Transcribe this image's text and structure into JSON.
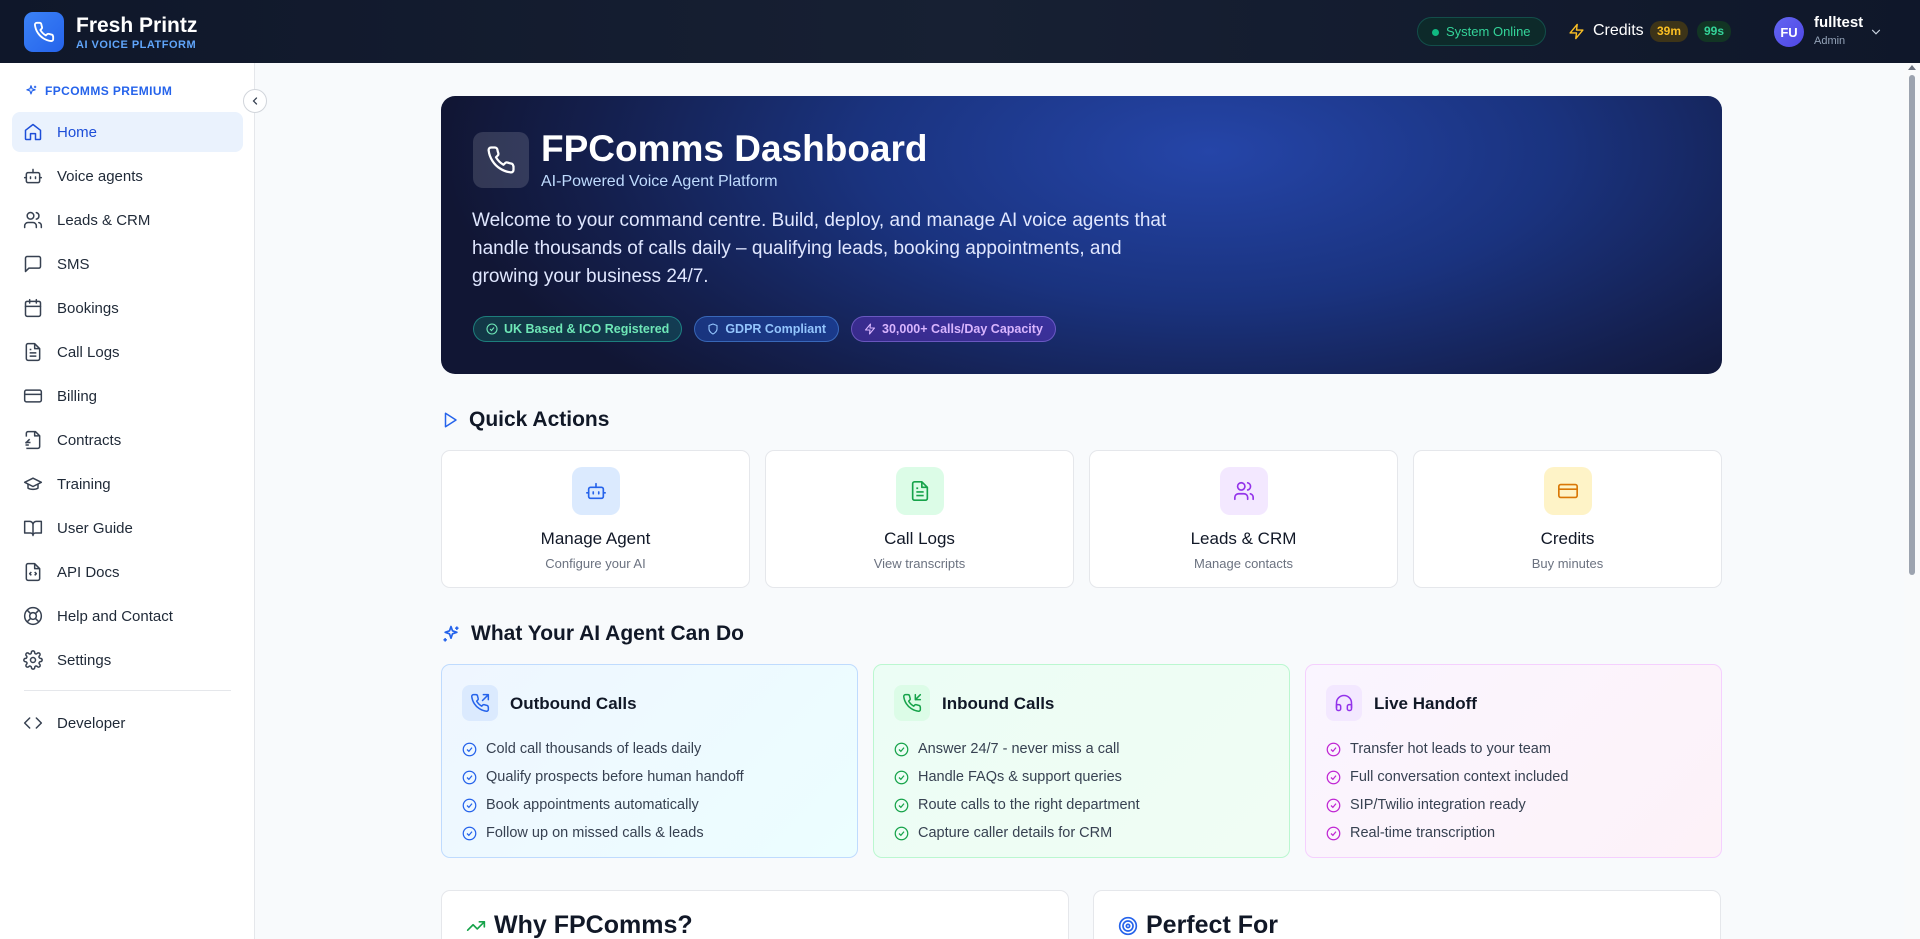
{
  "brand": {
    "name": "Fresh Printz",
    "subtitle": "AI VOICE PLATFORM"
  },
  "header": {
    "status": "System Online",
    "credits_label": "Credits",
    "credits_minutes": "39m",
    "credits_seconds": "99s",
    "user": {
      "initials": "FU",
      "name": "fulltest",
      "role": "Admin"
    }
  },
  "sidebar": {
    "section": "FPCOMMS PREMIUM",
    "items": [
      {
        "label": "Home",
        "icon": "home-icon",
        "active": true
      },
      {
        "label": "Voice agents",
        "icon": "bot-icon"
      },
      {
        "label": "Leads & CRM",
        "icon": "users-icon"
      },
      {
        "label": "SMS",
        "icon": "message-icon"
      },
      {
        "label": "Bookings",
        "icon": "calendar-icon"
      },
      {
        "label": "Call Logs",
        "icon": "file-text-icon"
      },
      {
        "label": "Billing",
        "icon": "credit-card-icon"
      },
      {
        "label": "Contracts",
        "icon": "contract-icon"
      },
      {
        "label": "Training",
        "icon": "graduation-cap-icon"
      },
      {
        "label": "User Guide",
        "icon": "book-icon"
      },
      {
        "label": "API Docs",
        "icon": "code-file-icon"
      },
      {
        "label": "Help and Contact",
        "icon": "lifebuoy-icon"
      },
      {
        "label": "Settings",
        "icon": "gear-icon"
      }
    ],
    "developer": {
      "label": "Developer",
      "icon": "code-icon"
    }
  },
  "hero": {
    "title": "FPComms Dashboard",
    "subtitle": "AI-Powered Voice Agent Platform",
    "description": "Welcome to your command centre. Build, deploy, and manage AI voice agents that handle thousands of calls daily – qualifying leads, booking appointments, and growing your business 24/7.",
    "badges": [
      "UK Based & ICO Registered",
      "GDPR Compliant",
      "30,000+ Calls/Day Capacity"
    ]
  },
  "quick_actions": {
    "title": "Quick Actions",
    "items": [
      {
        "title": "Manage Agent",
        "subtitle": "Configure your AI",
        "icon": "bot-icon",
        "color": "#2563eb"
      },
      {
        "title": "Call Logs",
        "subtitle": "View transcripts",
        "icon": "file-text-icon",
        "color": "#16a34a"
      },
      {
        "title": "Leads & CRM",
        "subtitle": "Manage contacts",
        "icon": "users-icon",
        "color": "#9333ea"
      },
      {
        "title": "Credits",
        "subtitle": "Buy minutes",
        "icon": "credit-card-icon",
        "color": "#d97706"
      }
    ]
  },
  "capabilities": {
    "title": "What Your AI Agent Can Do",
    "cards": [
      {
        "title": "Outbound Calls",
        "icon": "phone-outgoing-icon",
        "color": "#2563eb",
        "items": [
          "Cold call thousands of leads daily",
          "Qualify prospects before human handoff",
          "Book appointments automatically",
          "Follow up on missed calls & leads"
        ]
      },
      {
        "title": "Inbound Calls",
        "icon": "phone-incoming-icon",
        "color": "#16a34a",
        "items": [
          "Answer 24/7 - never miss a call",
          "Handle FAQs & support queries",
          "Route calls to the right department",
          "Capture caller details for CRM"
        ]
      },
      {
        "title": "Live Handoff",
        "icon": "headphones-icon",
        "color": "#9333ea",
        "items": [
          "Transfer hot leads to your team",
          "Full conversation context included",
          "SIP/Twilio integration ready",
          "Real-time transcription"
        ]
      }
    ]
  },
  "why": {
    "title": "Why FPComms?",
    "icon": "trending-up-icon"
  },
  "perfect": {
    "title": "Perfect For",
    "icon": "target-icon"
  },
  "colors": {
    "accent": "#2563eb",
    "topbar": "#0f172a",
    "online": "#10b981"
  }
}
